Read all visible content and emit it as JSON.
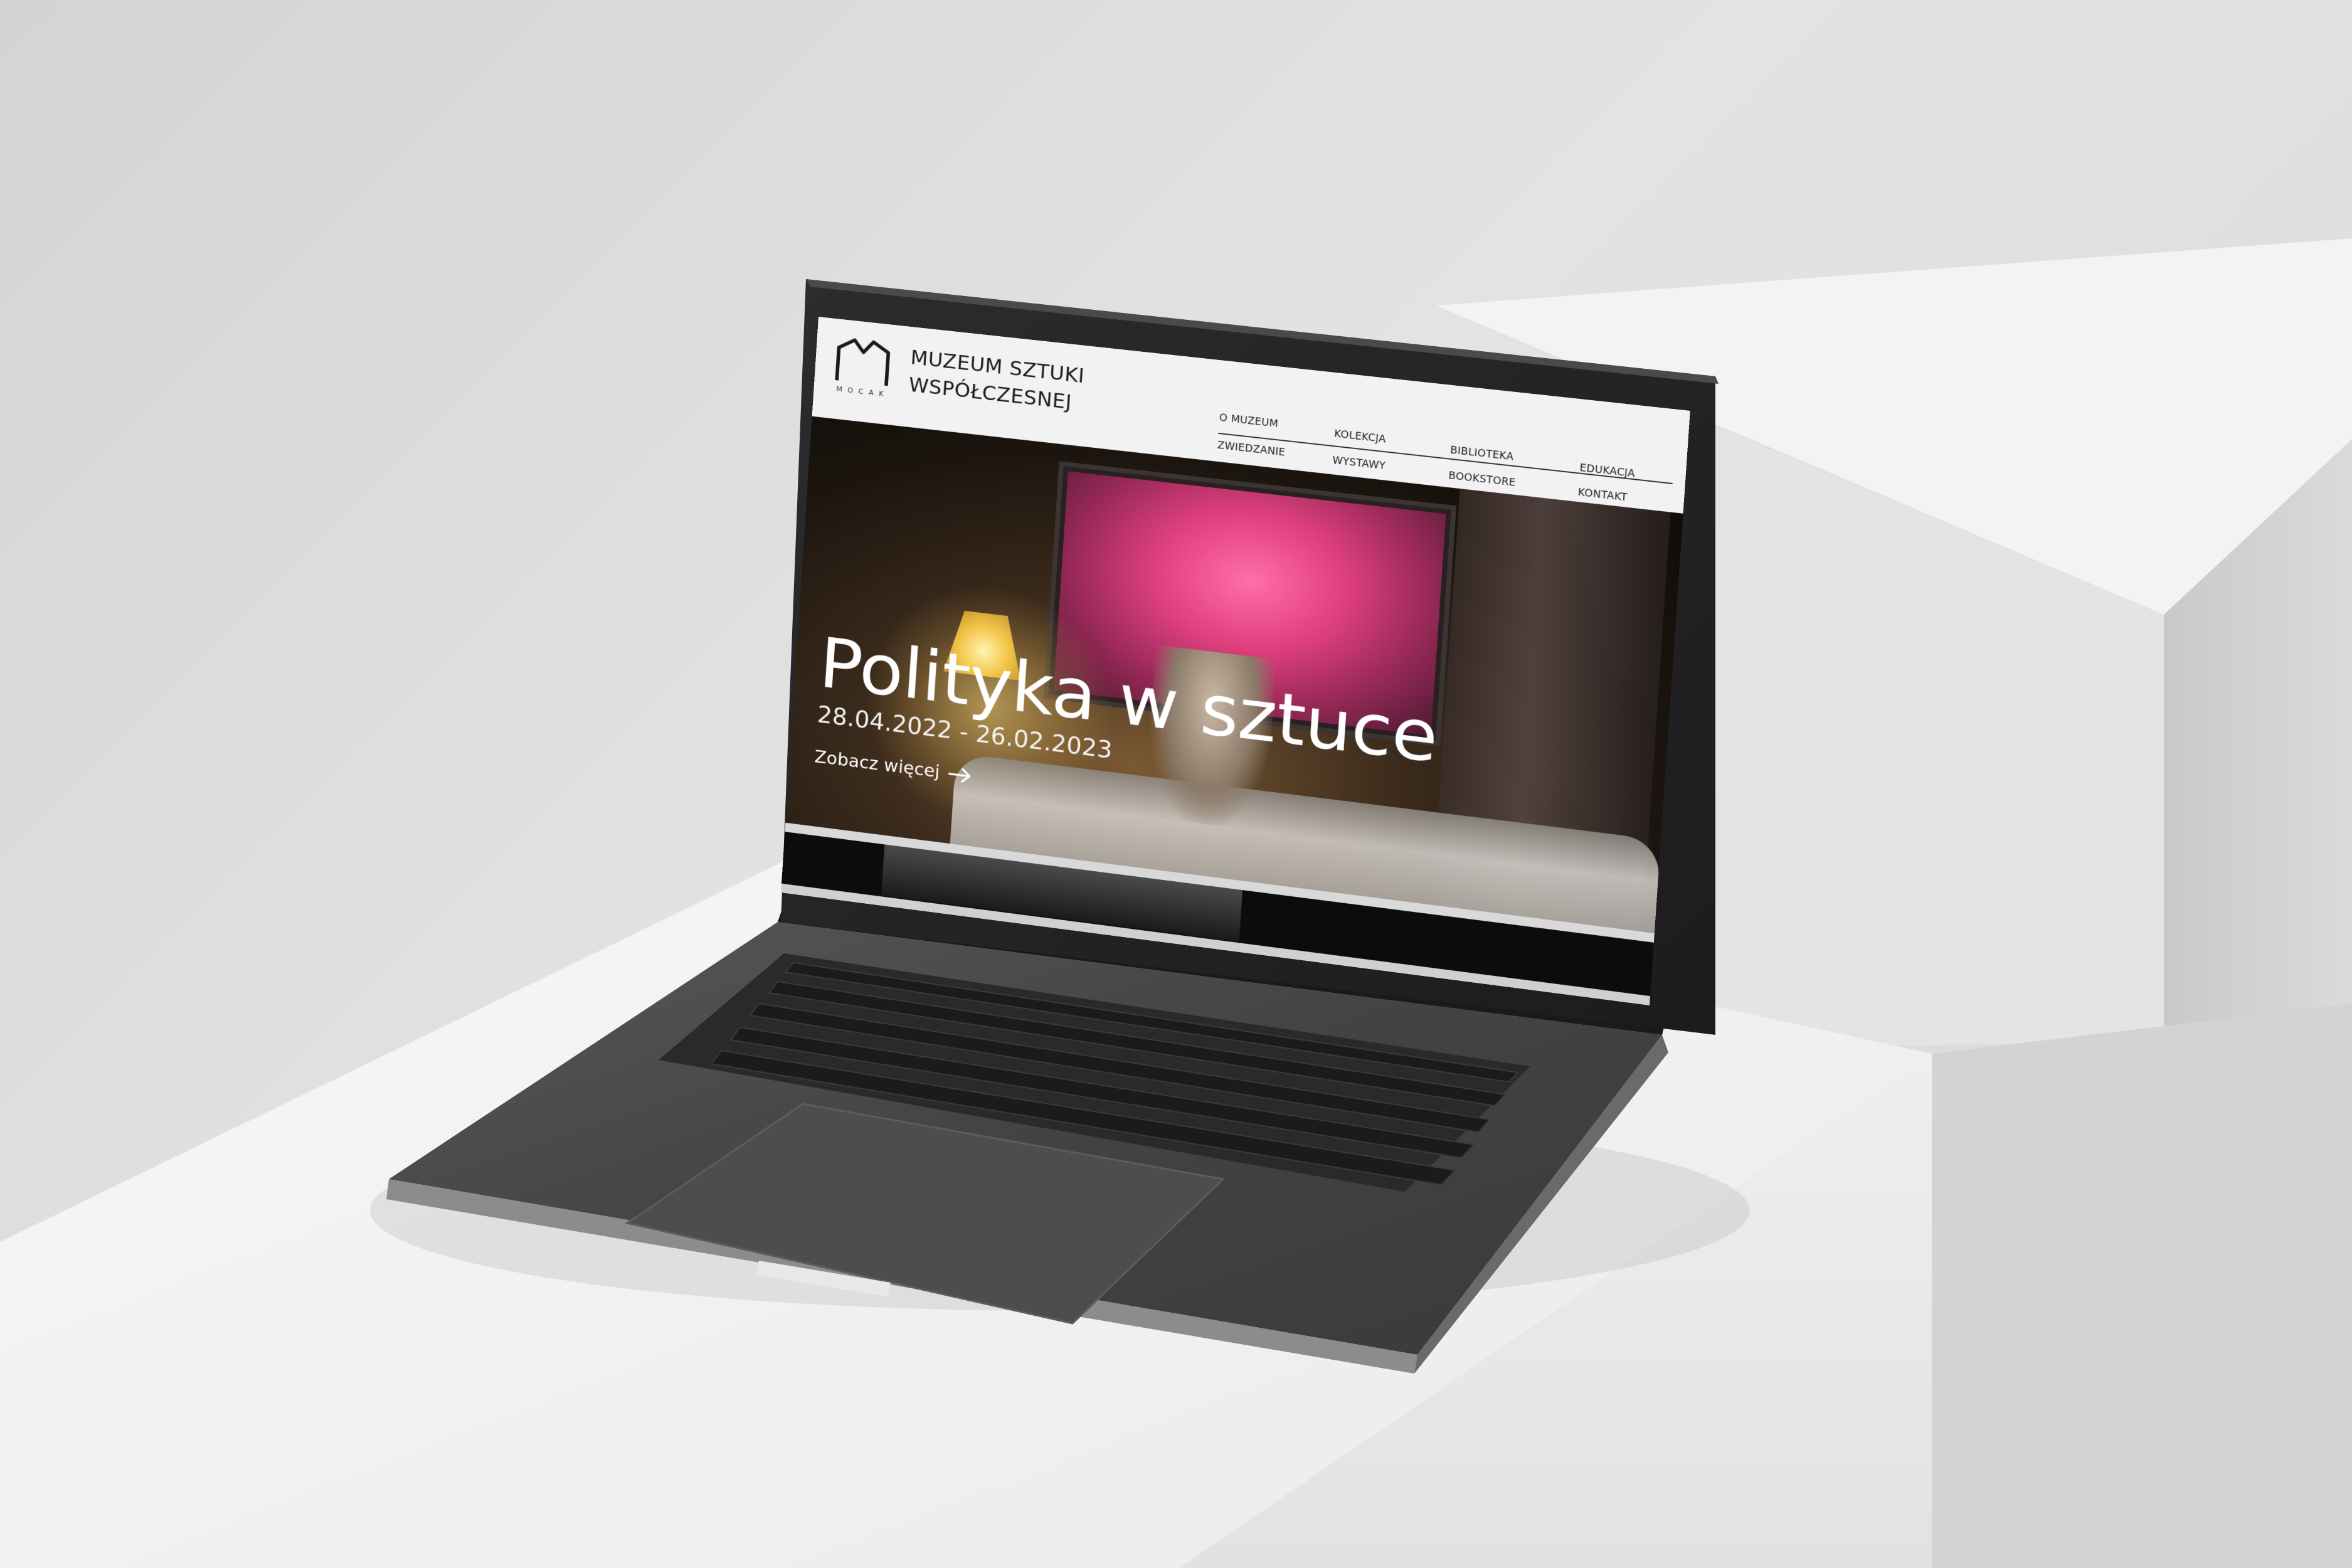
{
  "site": {
    "logo_text": "MOCAK",
    "title_line1": "MUZEUM SZTUKI",
    "title_line2": "WSPÓŁCZESNEJ"
  },
  "nav": {
    "row1": [
      "O MUZEUM",
      "KOLEKCJA",
      "BIBLIOTEKA",
      "EDUKACJA"
    ],
    "row2": [
      "ZWIEDZANIE",
      "WYSTAWY",
      "BOOKSTORE",
      "KONTAKT"
    ]
  },
  "hero": {
    "title": "Polityka w sztuce",
    "dates": "28.04.2022 - 26.02.2023",
    "cta": "Zobacz więcej"
  },
  "colors": {
    "header_bg": "#f2f2f2",
    "hero_text": "#ffffff",
    "laptop_body": "#3b3b3d",
    "pedestal": "#f4f4f4",
    "wall": "#dcdcdc"
  },
  "icons": [
    "mocak-logo-icon",
    "arrow-right-icon"
  ]
}
